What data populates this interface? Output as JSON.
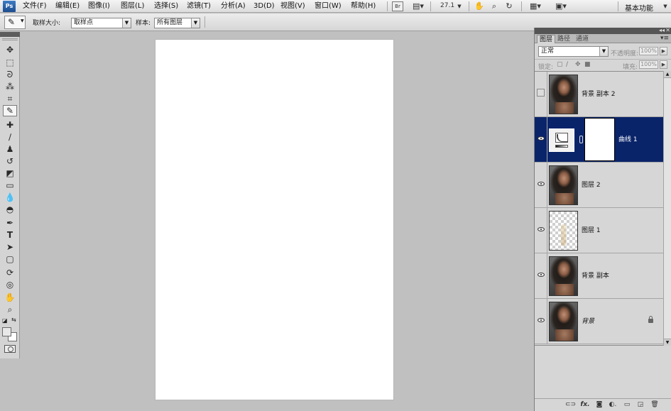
{
  "menubar": {
    "logo": "Ps",
    "items": [
      "文件(F)",
      "编辑(E)",
      "图像(I)",
      "图层(L)",
      "选择(S)",
      "滤镜(T)",
      "分析(A)",
      "3D(D)",
      "视图(V)",
      "窗口(W)",
      "帮助(H)"
    ],
    "zoom": "27.1",
    "workspace": "基本功能"
  },
  "options": {
    "sample_size_label": "取样大小:",
    "sample_size_value": "取样点",
    "sample_label": "样本:",
    "sample_value": "所有图层"
  },
  "panel": {
    "tabs": [
      "图层",
      "路径",
      "通道"
    ],
    "blend_mode": "正常",
    "opacity_label": "不透明度:",
    "opacity_value": "100%",
    "lock_label": "锁定:",
    "fill_label": "填充:",
    "fill_value": "100%"
  },
  "layers": [
    {
      "name": "背景 副本 2",
      "visible": false,
      "thumb": "photo",
      "selected": false
    },
    {
      "name": "曲线 1",
      "visible": true,
      "thumb": "curves",
      "selected": true
    },
    {
      "name": "图层 2",
      "visible": true,
      "thumb": "photo",
      "selected": false
    },
    {
      "name": "图层 1",
      "visible": true,
      "thumb": "transparent",
      "selected": false
    },
    {
      "name": "背景 副本",
      "visible": true,
      "thumb": "photo",
      "selected": false
    },
    {
      "name": "背景",
      "visible": true,
      "thumb": "photo",
      "selected": false,
      "locked": true,
      "italic": true
    }
  ],
  "colors": {
    "selected_row": "#0a246a",
    "workspace_bg": "#c0c0c0",
    "canvas": "#ffffff"
  },
  "icons": {
    "toolbox": [
      "move-icon",
      "marquee-icon",
      "lasso-icon",
      "quick-select-icon",
      "crop-icon",
      "eyedropper-icon",
      "healing-brush-icon",
      "brush-icon",
      "clone-stamp-icon",
      "history-brush-icon",
      "eraser-icon",
      "gradient-icon",
      "blur-icon",
      "dodge-icon",
      "pen-icon",
      "type-icon",
      "path-select-icon",
      "rectangle-icon",
      "3d-rotate-icon",
      "3d-orbit-icon",
      "hand-icon",
      "zoom-icon"
    ],
    "footer": [
      "link-layers-icon",
      "fx-icon",
      "add-mask-icon",
      "adjustment-layer-icon",
      "group-icon",
      "new-layer-icon",
      "trash-icon"
    ]
  }
}
